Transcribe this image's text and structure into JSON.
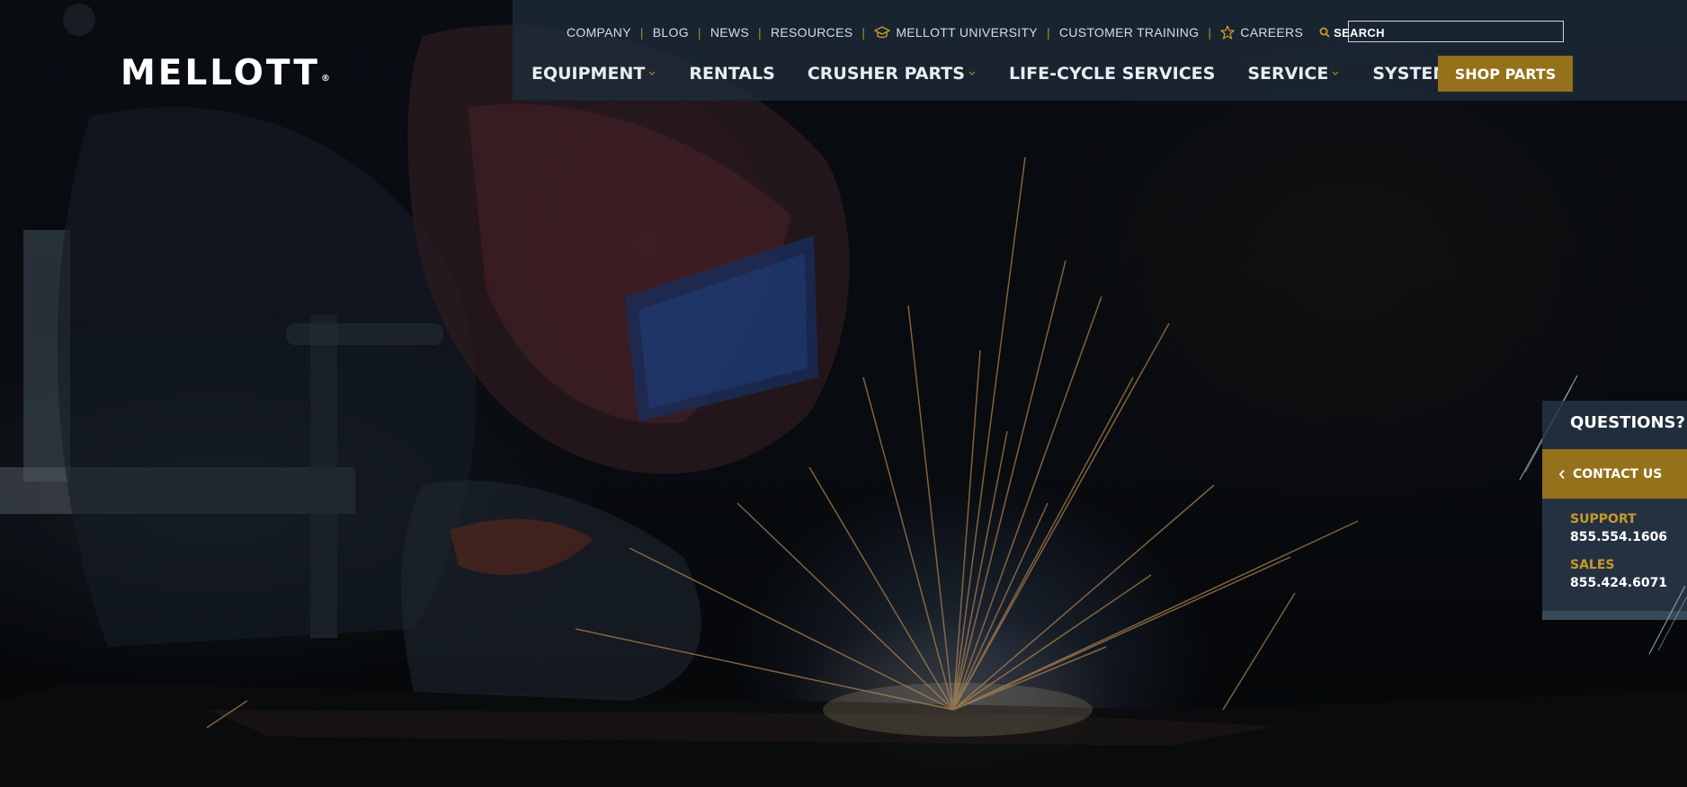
{
  "brand": {
    "logo_text": "MELLOTT",
    "registered_mark": "®"
  },
  "utility_nav": {
    "items": [
      {
        "label": "COMPANY",
        "icon": null
      },
      {
        "label": "BLOG",
        "icon": null
      },
      {
        "label": "NEWS",
        "icon": null
      },
      {
        "label": "RESOURCES",
        "icon": null
      },
      {
        "label": "MELLOTT UNIVERSITY",
        "icon": "graduation-cap-icon"
      },
      {
        "label": "CUSTOMER TRAINING",
        "icon": null
      },
      {
        "label": "CAREERS",
        "icon": "star-icon"
      }
    ],
    "search_label": "SEARCH",
    "search_placeholder": "",
    "search_value": ""
  },
  "main_nav": {
    "items": [
      {
        "label": "EQUIPMENT",
        "has_dropdown": true
      },
      {
        "label": "RENTALS",
        "has_dropdown": false
      },
      {
        "label": "CRUSHER PARTS",
        "has_dropdown": true
      },
      {
        "label": "LIFE-CYCLE SERVICES",
        "has_dropdown": false
      },
      {
        "label": "SERVICE",
        "has_dropdown": true
      },
      {
        "label": "SYSTEMS",
        "has_dropdown": false
      }
    ],
    "cta_label": "SHOP PARTS"
  },
  "contact_widget": {
    "title": "QUESTIONS?",
    "button_label": "CONTACT US",
    "support_label": "SUPPORT",
    "support_phone": "855.554.1606",
    "sales_label": "SALES",
    "sales_phone": "855.424.6071"
  },
  "colors": {
    "accent_gold": "#94711a",
    "nav_band": "#1e2c3a",
    "panel_dark": "#233141",
    "text_white": "#ffffff"
  }
}
